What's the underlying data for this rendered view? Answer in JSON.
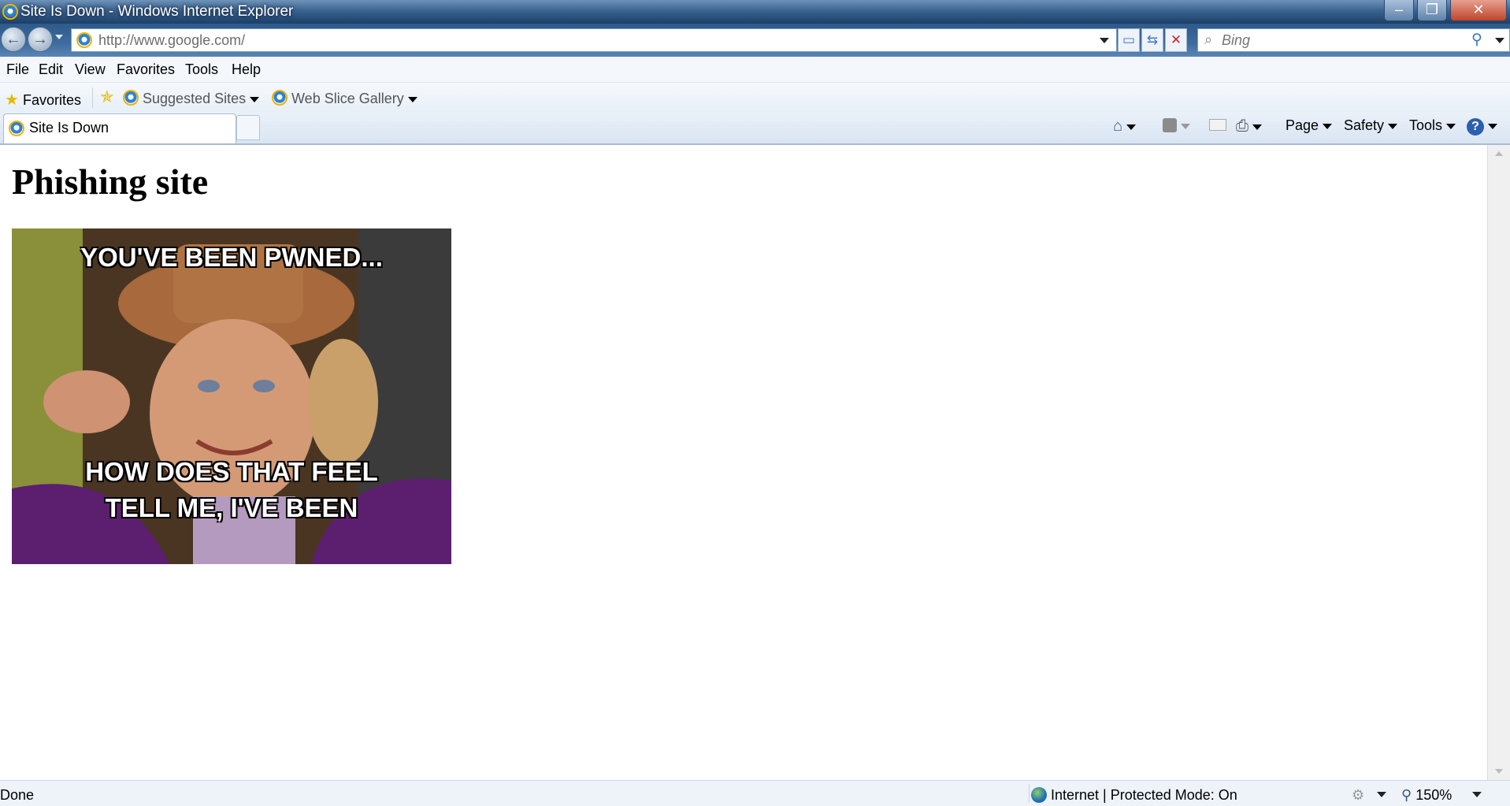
{
  "window": {
    "title": "Site Is Down - Windows Internet Explorer",
    "controls": {
      "minimize": "–",
      "restore": "❐",
      "close": "✕"
    }
  },
  "address_bar": {
    "url": "http://www.google.com/",
    "search_placeholder": "Bing"
  },
  "menu": [
    "File",
    "Edit",
    "View",
    "Favorites",
    "Tools",
    "Help"
  ],
  "favorites_bar": {
    "favorites_label": "Favorites",
    "items": [
      "Suggested Sites",
      "Web Slice Gallery"
    ]
  },
  "tab": {
    "title": "Site Is Down"
  },
  "command_bar": [
    "Page",
    "Safety",
    "Tools"
  ],
  "page": {
    "heading": "Phishing site",
    "meme": {
      "top_text": "YOU'VE BEEN PWNED...",
      "bottom_line1": "HOW DOES THAT FEEL",
      "bottom_line2": "TELL ME, I'VE BEEN"
    }
  },
  "status": {
    "left": "Done",
    "zone": "Internet | Protected Mode: On",
    "zoom": "150%"
  },
  "colors": {
    "titlebar": "#3a6390",
    "menu_bg": "#f4f7fb",
    "accent": "#2c83d6"
  }
}
